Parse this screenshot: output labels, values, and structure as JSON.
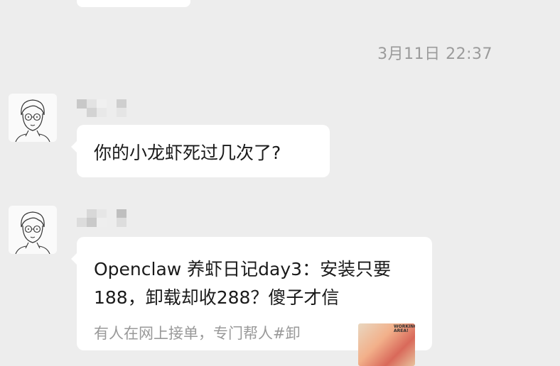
{
  "chat": {
    "timestamp": "3月11日 22:37",
    "messages": [
      {
        "text": "你的小龙虾死过几次了?"
      },
      {
        "card_title": "Openclaw 养虾日记day3：安装只要188，卸载却收288？傻子才信",
        "card_desc": "有人在网上接单，专门帮人#卸",
        "card_thumb_text": "WORKING AREA!"
      }
    ]
  },
  "colors": {
    "background": "#ededed",
    "bubble": "#ffffff",
    "timestamp": "#9b9b9b"
  },
  "icons": {
    "avatar": "cartoon-man-with-glasses-avatar"
  }
}
